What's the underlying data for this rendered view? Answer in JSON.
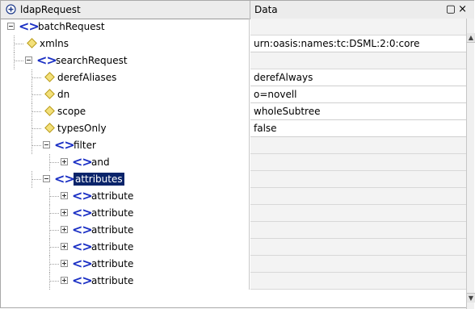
{
  "header": {
    "name_column": "ldapRequest",
    "data_column": "Data",
    "restore_glyph": "▢",
    "close_glyph": "×"
  },
  "rows": [
    {
      "label": "batchRequest",
      "type": "element",
      "expanded": true,
      "data": ""
    },
    {
      "label": "xmlns",
      "type": "attribute",
      "data": "urn:oasis:names:tc:DSML:2:0:core"
    },
    {
      "label": "searchRequest",
      "type": "element",
      "expanded": true,
      "data": ""
    },
    {
      "label": "derefAliases",
      "type": "attribute",
      "data": "derefAlways"
    },
    {
      "label": "dn",
      "type": "attribute",
      "data": "o=novell"
    },
    {
      "label": "scope",
      "type": "attribute",
      "data": "wholeSubtree"
    },
    {
      "label": "typesOnly",
      "type": "attribute",
      "data": "false"
    },
    {
      "label": "filter",
      "type": "element",
      "expanded": true,
      "data": ""
    },
    {
      "label": "and",
      "type": "element",
      "expanded": false,
      "data": ""
    },
    {
      "label": "attributes",
      "type": "element",
      "expanded": true,
      "selected": true,
      "data": ""
    },
    {
      "label": "attribute",
      "type": "element",
      "expanded": false,
      "data": ""
    },
    {
      "label": "attribute",
      "type": "element",
      "expanded": false,
      "data": ""
    },
    {
      "label": "attribute",
      "type": "element",
      "expanded": false,
      "data": ""
    },
    {
      "label": "attribute",
      "type": "element",
      "expanded": false,
      "data": ""
    },
    {
      "label": "attribute",
      "type": "element",
      "expanded": false,
      "data": ""
    },
    {
      "label": "attribute",
      "type": "element",
      "expanded": false,
      "data": ""
    }
  ],
  "icons": {
    "header": "circle-plus-icon",
    "element": "xml-element-icon",
    "attribute": "xml-attribute-icon",
    "element_glyph": "<>"
  },
  "colors": {
    "element_icon": "#1a2fc4",
    "attribute_icon": "#f3e07a",
    "selection": "#0a246a"
  }
}
